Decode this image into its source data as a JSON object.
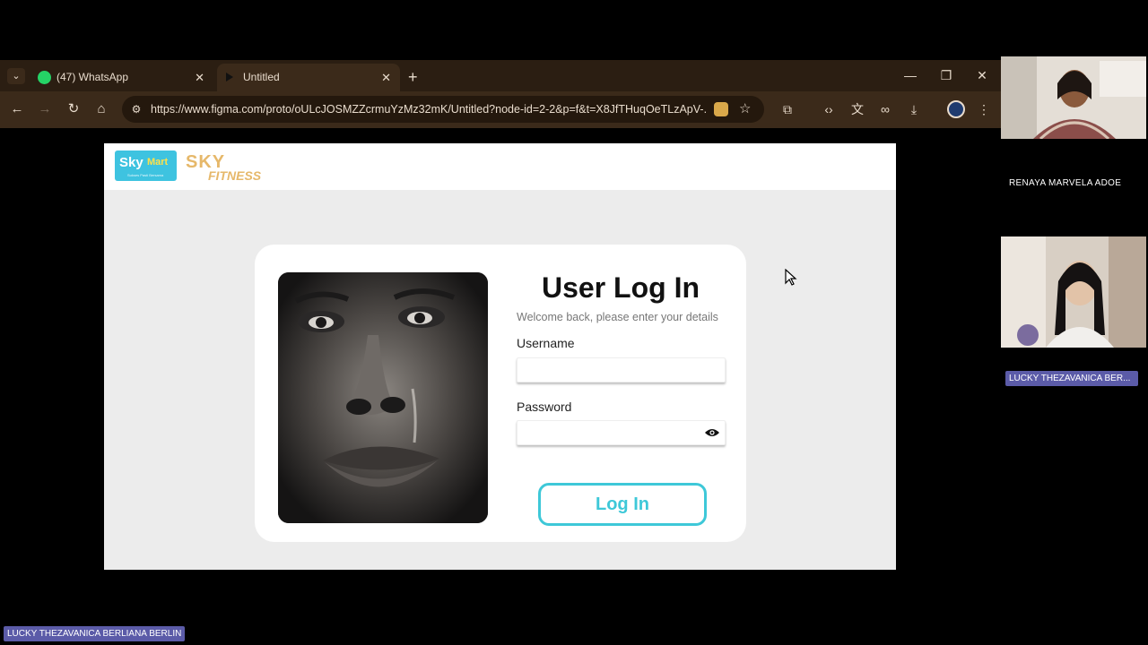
{
  "browser": {
    "tabs": [
      {
        "label": "(47) WhatsApp",
        "active": false,
        "icon": "whatsapp-icon"
      },
      {
        "label": "Untitled",
        "active": true,
        "icon": "figma-play-icon"
      }
    ],
    "url": "https://www.figma.com/proto/oULcJOSMZZcrmuYzMz32mK/Untitled?node-id=2-2&p=f&t=X8JfTHuqOeTLzApV-..."
  },
  "page": {
    "logos": {
      "skymart": {
        "sky": "Sky",
        "mart": "Mart",
        "tagline": "Sukses Pasti Bersama"
      },
      "skyfitness": {
        "sky": "SKY",
        "fitness": "FITNESS"
      }
    },
    "login": {
      "title": "User Log In",
      "subtitle": "Welcome back, please enter your details",
      "username_label": "Username",
      "password_label": "Password",
      "button_label": "Log In"
    },
    "colors": {
      "accent": "#3ec8d8",
      "skymart_bg": "#3ec3e0",
      "skyfitness": "#e6b86a"
    }
  },
  "meeting": {
    "participants": [
      {
        "name": "RENAYA MARVELA ADOE"
      },
      {
        "name": "LUCKY THEZAVANICA BER..."
      }
    ],
    "presenter_label": "LUCKY THEZAVANICA BERLIANA BERLIN"
  }
}
